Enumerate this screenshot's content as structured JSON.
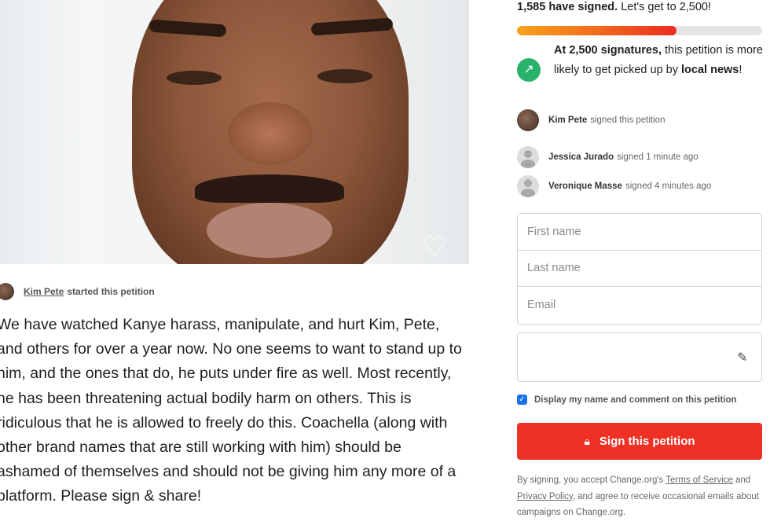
{
  "hero": {
    "favorite_icon": "heart-icon"
  },
  "starter": {
    "name": "Kim Pete",
    "action": "started this petition"
  },
  "story": "We have watched Kanye harass, manipulate, and hurt Kim, Pete, and others for over a year now. No one seems to want to stand up to him, and the ones that do, he puts under fire as well. Most recently, he has been threatening actual bodily harm on others. This is ridiculous that he is allowed to freely do this. Coachella (along with other brand names that are still working with him) should be ashamed of themselves and should not be giving him any more of a platform. Please sign & share!",
  "signatures": {
    "count_text": "1,585 have signed.",
    "goal_text": "Let's get to 2,500!",
    "current": 1585,
    "goal": 2500,
    "progress_fraction": 0.65,
    "progress_colors": [
      "#f7a21b",
      "#f36b1c",
      "#ec2c22"
    ]
  },
  "milestone": {
    "icon": "trending-up-icon",
    "icon_color": "#27b36a",
    "lead": "At 2,500 signatures,",
    "middle": " this petition is more likely to get picked up by ",
    "highlight": "local news",
    "end": "!"
  },
  "recent_signers": [
    {
      "name": "Kim Pete",
      "action": "signed this petition",
      "avatar": "photo"
    },
    {
      "name": "Jessica Jurado",
      "action": "signed 1 minute ago",
      "avatar": "default-avatar"
    },
    {
      "name": "Veronique Masse",
      "action": "signed 4 minutes ago",
      "avatar": "default-avatar"
    }
  ],
  "form": {
    "first_name_placeholder": "First name",
    "last_name_placeholder": "Last name",
    "email_placeholder": "Email",
    "comment_value": "",
    "edit_icon": "edit-pencil-icon",
    "display_checked": true,
    "display_label": "Display my name and comment on this petition"
  },
  "sign_button": {
    "label": "Sign this petition",
    "icon": "lock-icon",
    "color": "#ee3124"
  },
  "legal": {
    "prefix": "By signing, you accept Change.org's ",
    "terms": "Terms of Service",
    "and1": " and ",
    "privacy": "Privacy Policy",
    "suffix": ", and agree to receive occasional emails about campaigns on Change.org."
  }
}
